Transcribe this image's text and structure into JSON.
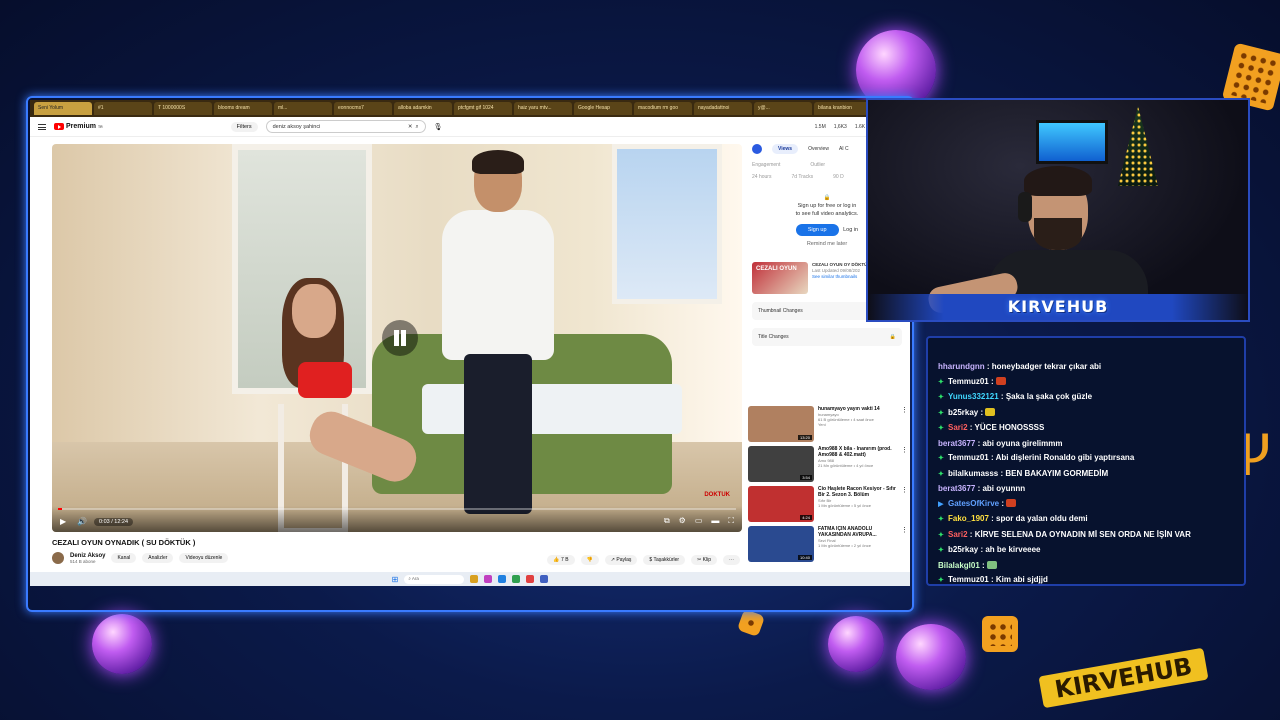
{
  "browser": {
    "tabs": [
      "Seni Yolum",
      "#1",
      "T 1000000S",
      "blooms dream",
      "ml...",
      "eonnocms7",
      "alloba adamkin",
      "ptcfgmt gif 1024",
      "haiz yaru mtv...",
      "Google Hesap",
      "macodium rm goo",
      "nayadadattnoi",
      "y@...",
      "bilana kranbion",
      "moni ..."
    ],
    "active_tab_index": 0
  },
  "youtube": {
    "logo": "Premium",
    "logo_superscript": "TR",
    "filters_label": "Filters",
    "search_value": "deniz aksoy şahinci",
    "header_stats": [
      "1.5M",
      "1,6K3",
      "1.6K",
      "2.1K",
      "Olup"
    ],
    "video_title": "CEZALI OYUN OYNADIK ( SU DÖKTÜK )",
    "channel_name": "Deniz Aksoy",
    "channel_subs": "514 B abone",
    "channel_buttons": [
      "Kanal",
      "Analizler",
      "Videoyu düzenle"
    ],
    "actions": [
      "7 B",
      "Paylaş",
      "Taşakkürler",
      "Klip"
    ],
    "time_display": "0:03 / 12:24",
    "progress_fraction": 0.004,
    "watermark": "DOKTUK"
  },
  "analytics": {
    "tabs": [
      "Views",
      "Overview",
      "AI C"
    ],
    "active_tab": "Views",
    "metrics": [
      "Engagement",
      "Outlier"
    ],
    "ranges": [
      "24 hours",
      "7d Tracks",
      "90 D"
    ],
    "signup_text_1": "Sign up for free or log in",
    "signup_text_2": "to see full video analytics.",
    "signup_button": "Sign up",
    "login_link": "Log in",
    "remind_later": "Remind me later",
    "thumb_card": {
      "thumb_text": "CEZALI OYUN",
      "title": "CEZALI OYUN OY DÖKTÜK )",
      "updated": "Last Updated 09/08/202",
      "link": "See similar thumbnails"
    },
    "locked_rows": [
      "Thumbnail Changes",
      "Title Changes"
    ]
  },
  "related": [
    {
      "title": "hunamyayo yayın vakti 14",
      "channel": "hunamyayo",
      "meta": "61 B görüntüleme • 4 saat önce",
      "badge": "Yeni",
      "duration": "13:20",
      "color": "#b08060"
    },
    {
      "title": "Amo988 X bila - İnanırım (prod. Amo988 & 402.matt)",
      "channel": "Amo 988",
      "meta": "21 Mn görüntüleme • 4 yıl önce",
      "badge": "",
      "duration": "3:54",
      "color": "#404040"
    },
    {
      "title": "Cio Haşlete Racon Kesiyor - Sıfır Bir 2. Sezon 3. Bölüm",
      "channel": "Sıfır Bir",
      "meta": "1 Mn görüntüleme • 5 yıl önce",
      "badge": "",
      "duration": "4:24",
      "color": "#c03030"
    },
    {
      "title": "FATMA İÇİN ANADOLU YAKASINDAN AVRUPA...",
      "channel": "Sezi Final",
      "meta": "1 Mn görüntüleme • 2 yıl önce",
      "badge": "",
      "duration": "10:40",
      "color": "#2a4a90"
    }
  ],
  "taskbar": {
    "search_placeholder": "Ara"
  },
  "webcam": {
    "logo": "KIRVEHUB"
  },
  "chat": [
    {
      "user": "hharundgnn",
      "text": "honeybadger tekrar çıkar abi",
      "color": "#c8b4ff",
      "badge": ""
    },
    {
      "user": "Temmuz01",
      "text": "",
      "color": "#ffffff",
      "badge": "✦",
      "emote": "#d04020"
    },
    {
      "user": "Yunus332121",
      "text": "Şaka la şaka çok güzle",
      "color": "#40d8ff",
      "badge": "✦"
    },
    {
      "user": "b25rkay",
      "text": "",
      "color": "#ffffff",
      "badge": "✦",
      "emote": "#e0c020"
    },
    {
      "user": "Sari2",
      "text": "YÜCE HONOSSSS",
      "color": "#ff6060",
      "badge": "✦"
    },
    {
      "user": "berat3677",
      "text": "abi oyuna girelimmm",
      "color": "#c8b4ff",
      "badge": ""
    },
    {
      "user": "Temmuz01",
      "text": "Abi dişlerini Ronaldo gibi yaptırsana",
      "color": "#ffffff",
      "badge": "✦"
    },
    {
      "user": "bilalkumasss",
      "text": "BEN BAKAYIM GORMEDİM",
      "color": "#ffffff",
      "badge": "✦"
    },
    {
      "user": "berat3677",
      "text": "abi oyunnn",
      "color": "#c8b4ff",
      "badge": ""
    },
    {
      "user": "GatesOfKirve",
      "text": "",
      "color": "#60a0ff",
      "badge": "▶",
      "emote": "#d04020"
    },
    {
      "user": "Fako_1907",
      "text": "spor da yalan oldu demi",
      "color": "#ffe040",
      "badge": "✦"
    },
    {
      "user": "Sari2",
      "text": "KİRVE SELENA DA OYNADIN Mİ SEN ORDA NE İŞİN VAR",
      "color": "#ff6060",
      "badge": "✦"
    },
    {
      "user": "b25rkay",
      "text": "ah be kirveeee",
      "color": "#ffffff",
      "badge": "✦"
    },
    {
      "user": "Bilalakgl01",
      "text": "",
      "color": "#c8ffc8",
      "badge": "",
      "emote": "#80c080"
    },
    {
      "user": "Temmuz01",
      "text": "Kim abi sjdjjd",
      "color": "#ffffff",
      "badge": "✦"
    }
  ],
  "brand": {
    "bottom_logo": "KIRVEHUB"
  }
}
